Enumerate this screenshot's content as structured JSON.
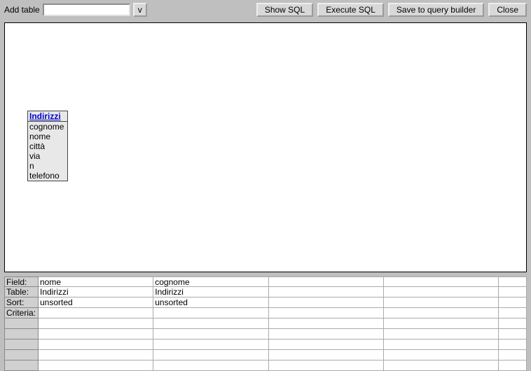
{
  "toolbar": {
    "add_table_label": "Add table",
    "add_table_value": "",
    "dropdown_symbol": "v",
    "show_sql": "Show SQL",
    "execute_sql": "Execute SQL",
    "save_to_builder": "Save to query builder",
    "close": "Close"
  },
  "table_box": {
    "title": "Indirizzi",
    "fields": [
      "cognome",
      "nome",
      "città",
      "via",
      "n",
      "telefono"
    ]
  },
  "grid": {
    "row_labels": [
      "Field:",
      "Table:",
      "Sort:",
      "Criteria:",
      "",
      "",
      "",
      "",
      ""
    ],
    "columns": [
      {
        "field": "nome",
        "table": "Indirizzi",
        "sort": "unsorted",
        "criteria": "",
        "r5": "",
        "r6": "",
        "r7": "",
        "r8": "",
        "r9": ""
      },
      {
        "field": "cognome",
        "table": "Indirizzi",
        "sort": "unsorted",
        "criteria": "",
        "r5": "",
        "r6": "",
        "r7": "",
        "r8": "",
        "r9": ""
      },
      {
        "field": "",
        "table": "",
        "sort": "",
        "criteria": "",
        "r5": "",
        "r6": "",
        "r7": "",
        "r8": "",
        "r9": ""
      },
      {
        "field": "",
        "table": "",
        "sort": "",
        "criteria": "",
        "r5": "",
        "r6": "",
        "r7": "",
        "r8": "",
        "r9": ""
      },
      {
        "field": "",
        "table": "",
        "sort": "",
        "criteria": "",
        "r5": "",
        "r6": "",
        "r7": "",
        "r8": "",
        "r9": ""
      }
    ]
  }
}
